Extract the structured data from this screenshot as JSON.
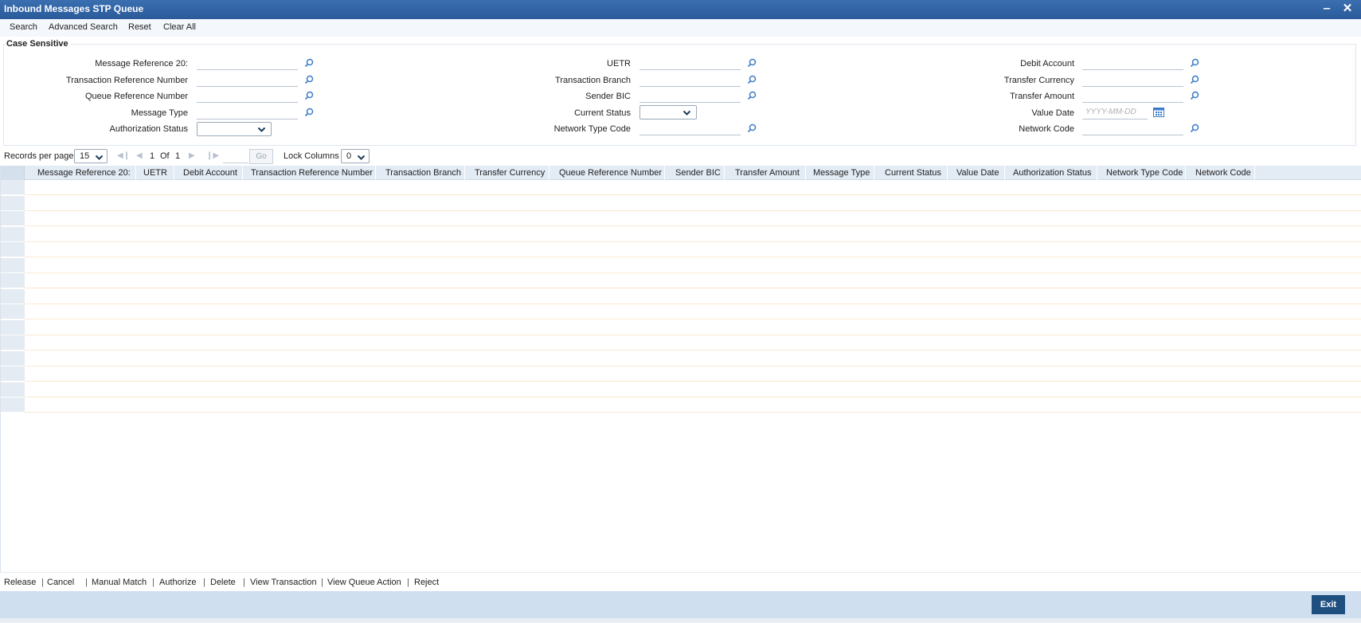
{
  "window": {
    "title": "Inbound Messages STP Queue",
    "minimize_glyph": "‒",
    "close_glyph": "✕"
  },
  "toolbar": {
    "search": "Search",
    "advanced_search": "Advanced Search",
    "reset": "Reset",
    "clear_all": "Clear All"
  },
  "search_panel": {
    "section_title": "Case Sensitive",
    "fields": {
      "message_reference_20": "Message Reference 20:",
      "transaction_reference_number": "Transaction Reference Number",
      "queue_reference_number": "Queue Reference Number",
      "message_type": "Message Type",
      "authorization_status": "Authorization Status",
      "uetr": "UETR",
      "transaction_branch": "Transaction Branch",
      "sender_bic": "Sender BIC",
      "current_status": "Current Status",
      "network_type_code": "Network Type Code",
      "debit_account": "Debit Account",
      "transfer_currency": "Transfer Currency",
      "transfer_amount": "Transfer Amount",
      "value_date": "Value Date",
      "network_code": "Network Code"
    },
    "value_date_placeholder": "YYYY-MM-DD"
  },
  "pager": {
    "records_per_page_label": "Records per page",
    "records_per_page_value": "15",
    "current_page": "1",
    "of_label": "Of",
    "total_pages": "1",
    "go_label": "Go",
    "lock_columns_label": "Lock Columns",
    "lock_columns_value": "0"
  },
  "grid": {
    "columns": [
      "Message Reference 20:",
      "UETR",
      "Debit Account",
      "Transaction Reference Number",
      "Transaction Branch",
      "Transfer Currency",
      "Queue Reference Number",
      "Sender BIC",
      "Transfer Amount",
      "Message Type",
      "Current Status",
      "Value Date",
      "Authorization Status",
      "Network Type Code",
      "Network Code"
    ],
    "row_count": 15
  },
  "actions": [
    "Release",
    "Cancel",
    "Manual Match",
    "Authorize",
    "Delete",
    "View Transaction",
    "View Queue Action",
    "Reject"
  ],
  "action_separator": "|",
  "footer": {
    "exit_label": "Exit"
  },
  "colors": {
    "title_bar": "#2a5a9a",
    "grid_header": "#e3ebf4",
    "row_line": "#fbe8d2",
    "footer": "#cfdff0",
    "exit_button": "#1f4f80"
  },
  "icons": {
    "lov": "search-icon",
    "calendar": "calendar-icon",
    "dropdown": "chevron-down-icon"
  }
}
